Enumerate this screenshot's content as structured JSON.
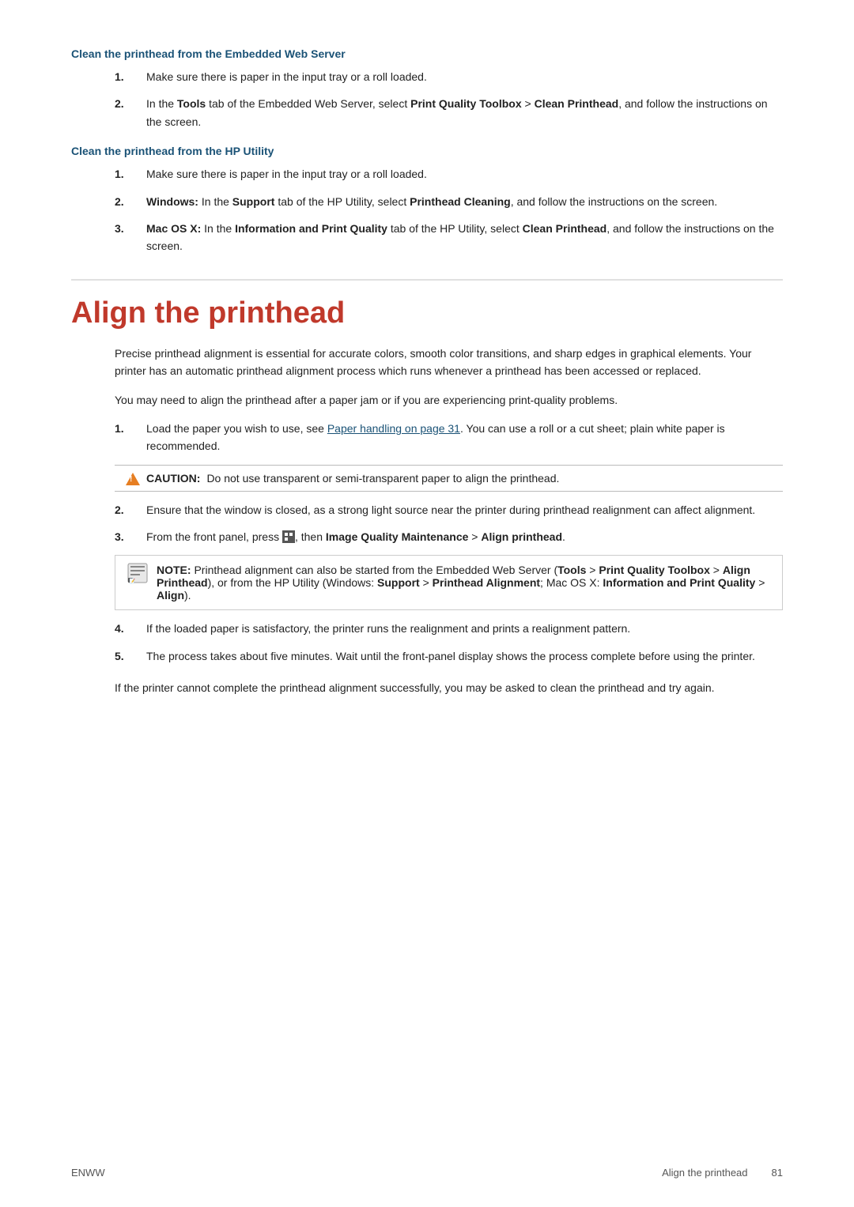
{
  "page": {
    "section1": {
      "heading": "Clean the printhead from the Embedded Web Server",
      "steps": [
        {
          "number": "1.",
          "text_plain": "Make sure there is paper in the input tray or a roll loaded.",
          "bold_parts": []
        },
        {
          "number": "2.",
          "text_intro": "In the ",
          "bold1": "Tools",
          "text2": " tab of the Embedded Web Server, select ",
          "bold2": "Print Quality Toolbox",
          "text3": " > ",
          "bold3": "Clean Printhead",
          "text4": ", and follow the instructions on the screen."
        }
      ]
    },
    "section2": {
      "heading": "Clean the printhead from the HP Utility",
      "steps": [
        {
          "number": "1.",
          "text_plain": "Make sure there is paper in the input tray or a roll loaded."
        },
        {
          "number": "2.",
          "text_intro": "",
          "bold1": "Windows:",
          "text2": " In the ",
          "bold2": "Support",
          "text3": " tab of the HP Utility, select ",
          "bold3": "Printhead Cleaning",
          "text4": ", and follow the instructions on the screen."
        },
        {
          "number": "3.",
          "text_intro": "",
          "bold1": "Mac OS X:",
          "text2": " In the ",
          "bold2": "Information and Print Quality",
          "text3": " tab of the HP Utility, select ",
          "bold3": "Clean Printhead",
          "text4": ", and follow the instructions on the screen."
        }
      ]
    },
    "main_heading": "Align the printhead",
    "para1": "Precise printhead alignment is essential for accurate colors, smooth color transitions, and sharp edges in graphical elements. Your printer has an automatic printhead alignment process which runs whenever a printhead has been accessed or replaced.",
    "para2": "You may need to align the printhead after a paper jam or if you are experiencing print-quality problems.",
    "step1": {
      "number": "1.",
      "text_intro": "Load the paper you wish to use, see ",
      "link_text": "Paper handling on page 31",
      "text_after": ". You can use a roll or a cut sheet; plain white paper is recommended."
    },
    "caution": {
      "label": "CAUTION:",
      "text": "Do not use transparent or semi-transparent paper to align the printhead."
    },
    "step2": {
      "number": "2.",
      "text": "Ensure that the window is closed, as a strong light source near the printer during printhead realignment can affect alignment."
    },
    "step3": {
      "number": "3.",
      "text_intro": "From the front panel, press ",
      "icon_placeholder": "▣",
      "text_after": ", then ",
      "bold1": "Image Quality Maintenance",
      "text_middle": " > ",
      "bold2": "Align printhead",
      "text_end": "."
    },
    "note": {
      "label": "NOTE:",
      "text_intro": "Printhead alignment can also be started from the Embedded Web Server (",
      "bold1": "Tools",
      "text2": " > ",
      "bold2": "Print Quality Toolbox",
      "text3": " > ",
      "bold3": "Align Printhead",
      "text4": "), or from the HP Utility (Windows: ",
      "bold4": "Support",
      "text5": " > ",
      "bold5": "Printhead Alignment",
      "text6": "; Mac OS X: ",
      "bold6": "Information and Print Quality",
      "text7": " > ",
      "bold7": "Align",
      "text8": ")."
    },
    "step4": {
      "number": "4.",
      "text": "If the loaded paper is satisfactory, the printer runs the realignment and prints a realignment pattern."
    },
    "step5": {
      "number": "5.",
      "text": "The process takes about five minutes. Wait until the front-panel display shows the process complete before using the printer."
    },
    "closing_para": "If the printer cannot complete the printhead alignment successfully, you may be asked to clean the printhead and try again.",
    "footer": {
      "left": "ENWW",
      "center": "Align the printhead",
      "page_number": "81"
    }
  }
}
